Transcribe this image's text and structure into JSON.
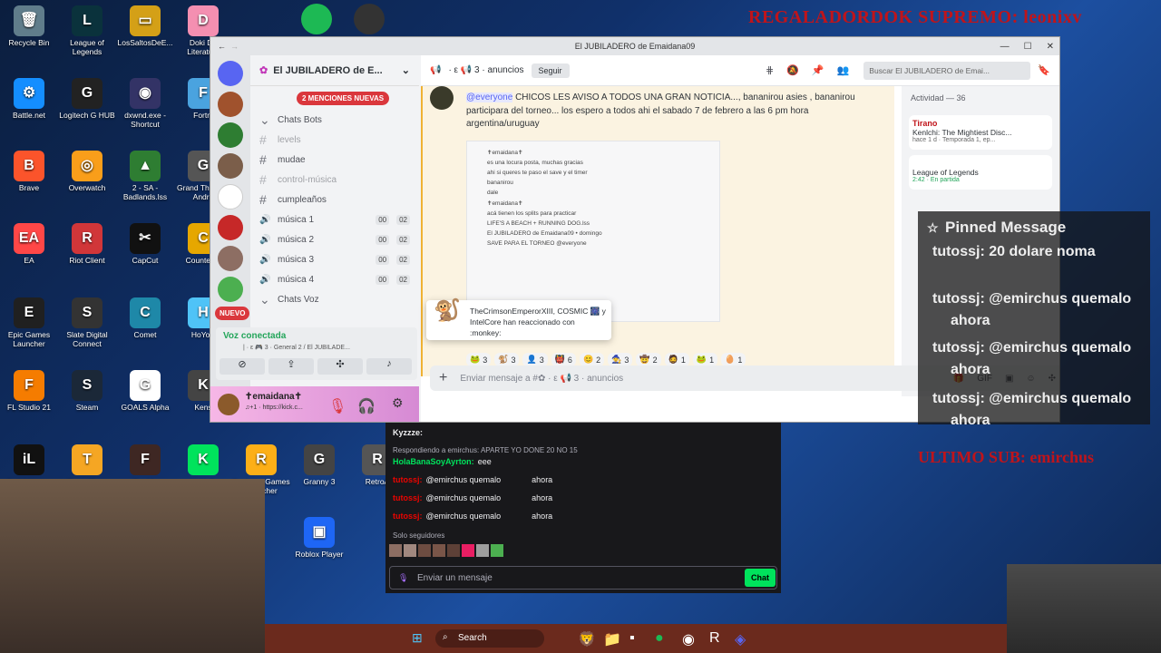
{
  "desktop": {
    "icons": [
      {
        "label": "Recycle Bin",
        "color": "#607d8b",
        "glyph": "🗑"
      },
      {
        "label": "League of Legends",
        "color": "#0a323c",
        "glyph": "L"
      },
      {
        "label": "LosSaltosDeE...",
        "color": "#d4a017",
        "glyph": "▭"
      },
      {
        "label": "Doki Do Literatu...",
        "color": "#f48fb1",
        "glyph": "D"
      },
      {
        "label": "Battle.net",
        "color": "#148eff",
        "glyph": "⚙"
      },
      {
        "label": "Logitech G HUB",
        "color": "#222222",
        "glyph": "G"
      },
      {
        "label": "dxwnd.exe - Shortcut",
        "color": "#333366",
        "glyph": "◉"
      },
      {
        "label": "Fortni",
        "color": "#4aa3df",
        "glyph": "F"
      },
      {
        "label": "Brave",
        "color": "#fb542b",
        "glyph": "B"
      },
      {
        "label": "Overwatch",
        "color": "#f99e1a",
        "glyph": "◎"
      },
      {
        "label": "2 - SA - Badlands.lss",
        "color": "#2e7d32",
        "glyph": "▲"
      },
      {
        "label": "Grand The San Andre",
        "color": "#555555",
        "glyph": "G"
      },
      {
        "label": "EA",
        "color": "#ff4747",
        "glyph": "EA"
      },
      {
        "label": "Riot Client",
        "color": "#d13639",
        "glyph": "R"
      },
      {
        "label": "CapCut",
        "color": "#111111",
        "glyph": "✂"
      },
      {
        "label": "Counter-S",
        "color": "#e6a700",
        "glyph": "C"
      },
      {
        "label": "Epic Games Launcher",
        "color": "#202020",
        "glyph": "E"
      },
      {
        "label": "Slate Digital Connect",
        "color": "#333333",
        "glyph": "S"
      },
      {
        "label": "Comet",
        "color": "#1e88a8",
        "glyph": "C"
      },
      {
        "label": "HoYoP",
        "color": "#4fc3f7",
        "glyph": "H"
      },
      {
        "label": "FL Studio 21",
        "color": "#f57c00",
        "glyph": "F"
      },
      {
        "label": "Steam",
        "color": "#1b2838",
        "glyph": "S"
      },
      {
        "label": "GOALS Alpha",
        "color": "#ffffff",
        "glyph": "G"
      },
      {
        "label": "Kens",
        "color": "#444444",
        "glyph": "K"
      },
      {
        "label": "iLok License Manager",
        "color": "#111111",
        "glyph": "iL"
      },
      {
        "label": "TunnelBear",
        "color": "#f5a623",
        "glyph": "T"
      },
      {
        "label": "Freddy Fazbear's Pizzeria Simulator",
        "color": "#3e2723",
        "glyph": "F"
      },
      {
        "label": "kicktalk",
        "color": "#00e35c",
        "glyph": "K"
      },
      {
        "label": "Rockstar Games Launcher",
        "color": "#fcaf17",
        "glyph": "R"
      },
      {
        "label": "Granny 3",
        "color": "#444444",
        "glyph": "G"
      },
      {
        "label": "RetroA",
        "color": "#555555",
        "glyph": "R"
      },
      {
        "label": "Roblox Player",
        "color": "#1e66f5",
        "glyph": "▣"
      }
    ],
    "top_icons": [
      {
        "label": "Spotify",
        "color": "#1db954"
      },
      {
        "label": "Games",
        "color": "#333333"
      }
    ],
    "overlay_title": "REGALADORDOK SUPREMO: leonixv",
    "overlay_sub": "ULTIMO SUB: emirchus"
  },
  "browser": {
    "url": "kick.com/popout/emaidana09/chat - Brave",
    "title": "El JUBILADERO de Emaidana09"
  },
  "discord": {
    "server_name": "El JUBILADERO de E...",
    "mentions_badge": "2 MENCIONES NUEVAS",
    "nuevo_badge": "NUEVO",
    "channels": [
      {
        "type": "category",
        "name": "Chats Bots"
      },
      {
        "type": "text",
        "name": "levels",
        "muted": true
      },
      {
        "type": "text",
        "name": "mudae"
      },
      {
        "type": "text",
        "name": "control-música",
        "muted": true
      },
      {
        "type": "text",
        "name": "cumpleaños"
      },
      {
        "type": "voice",
        "name": "música 1",
        "c1": "00",
        "c2": "02"
      },
      {
        "type": "voice",
        "name": "música 2",
        "c1": "00",
        "c2": "02"
      },
      {
        "type": "voice",
        "name": "música 3",
        "c1": "00",
        "c2": "02"
      },
      {
        "type": "voice",
        "name": "música 4",
        "c1": "00",
        "c2": "02"
      },
      {
        "type": "category",
        "name": "Chats Voz"
      }
    ],
    "voice": {
      "status": "Voz conectada",
      "location": "| · ε 🎮 3 · General 2 / El JUBILADE..."
    },
    "user": {
      "name": "✝emaidana✝",
      "status": "♫+1 · https://kick.c..."
    },
    "channel_header": {
      "name": "· ε 📢 3 · anuncios",
      "follow": "Seguir",
      "search_placeholder": "Buscar El JUBILADERO de Emai..."
    },
    "message": {
      "author": "✝emaidana✝",
      "mention": "@everyone",
      "text": "CHICOS LES AVISO A TODOS UNA GRAN NOTICIA..., bananirou asies , bananirou participara del torneo... los espero a todos ahi el sabado 7 de febrero a las 6 pm hora argentina/uruguay"
    },
    "embed": {
      "lines": [
        "✝emaidana✝",
        "es una locura posta, muchas gracias",
        "ahi si queres te paso el save y el timer",
        "bananirou",
        "dale",
        "✝emaidana✝",
        "acá tienen los splits para practicar",
        "LIFE'S A BEACH + RUNNING DOG.lss",
        "El JUBILADERO de Emaidana09 • domingo",
        "SAVE PARA EL TORNEO @everyone"
      ]
    },
    "tooltip": "TheCrimsonEmperorXIII, COSMIC 🎆 y IntelCore han reaccionado con :monkey:",
    "reactions": [
      {
        "emoji": "🐸",
        "count": "3"
      },
      {
        "emoji": "🐒",
        "count": "3"
      },
      {
        "emoji": "👤",
        "count": "3"
      },
      {
        "emoji": "👹",
        "count": "6"
      },
      {
        "emoji": "😊",
        "count": "2"
      },
      {
        "emoji": "🧙",
        "count": "3"
      },
      {
        "emoji": "🤠",
        "count": "2"
      },
      {
        "emoji": "🧔",
        "count": "1"
      },
      {
        "emoji": "🐸",
        "count": "1"
      },
      {
        "emoji": "🥚",
        "count": "1"
      }
    ],
    "composer_placeholder": "Enviar mensaje a #✿ · ε 📢 3 · anuncios",
    "activity": {
      "header": "Actividad — 36",
      "cards": [
        {
          "user": "Tirano",
          "title": "Kenlchi: The Mightiest Disc...",
          "sub": "hace 1 d · Temporada 1, ep..."
        },
        {
          "user": "",
          "title": "League of Legends",
          "sub": "2:42 · En partida"
        }
      ]
    }
  },
  "pinned": {
    "title": "Pinned Message",
    "lines": [
      "tutossj: 20 dolare noma",
      "tutossj: @emirchus quemalo",
      "ahora",
      "tutossj: @emirchus quemalo",
      "ahora",
      "tutossj: @emirchus quemalo",
      "ahora"
    ]
  },
  "kick_chat": {
    "top_user": "Kyzzze:",
    "reply_label": "Respondiendo a emirchus: APARTE YO DONE 20 NO 15",
    "lines": [
      {
        "user": "HolaBanaSoyAyrton:",
        "text": "eee"
      },
      {
        "user": "tutossj:",
        "text": "@emirchus quemalo",
        "after": "ahora"
      },
      {
        "user": "tutossj:",
        "text": "@emirchus quemalo",
        "after": "ahora"
      },
      {
        "user": "tutossj:",
        "text": "@emirchus quemalo",
        "after": "ahora"
      }
    ],
    "followers_only": "Solo seguidores",
    "input_placeholder": "Enviar un mensaje",
    "chat_button": "Chat"
  },
  "taskbar": {
    "search": "Search"
  }
}
